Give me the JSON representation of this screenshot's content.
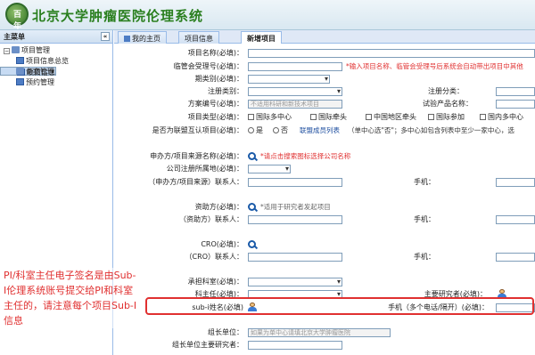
{
  "app": {
    "logo_mark": "百年",
    "title": "北京大学肿瘤医院伦理系统"
  },
  "sidebar": {
    "header": "主菜单",
    "collapse": "«",
    "root": "项目管理",
    "items": [
      {
        "label": "项目信息总览"
      },
      {
        "label": "项目信息"
      },
      {
        "label": "备案管理"
      },
      {
        "label": "预约管理"
      }
    ]
  },
  "tabs": [
    {
      "label": "我的主页"
    },
    {
      "label": "项目信息"
    },
    {
      "label": "新增项目"
    }
  ],
  "form": {
    "project_name": "项目名称(必填)：",
    "committee_no": "临管会受理号(必填)：",
    "committee_hint": "*输入项目名称、临管会受理号后系统会自动带出项目中其他",
    "phase": "期类别(必填)：",
    "reg_type": "注册类别：",
    "reg_class": "注册分类：",
    "protocol_no": "方案编号(必填)：",
    "protocol_placeholder": "不适用科研和新技术项目",
    "product_name": "试验产品名称：",
    "project_type": "项目类型(必填)：",
    "type_options": [
      "国际多中心",
      "国际牵头",
      "中国地区牵头",
      "国际参加",
      "国内多中心"
    ],
    "joint_review": "是否为联盟互认项目(必填)：",
    "yes": "是",
    "no": "否",
    "alliance_link": "联盟成员列表",
    "alliance_note": "（单中心选\"否\"；多中心如包含列表中至少一家中心，选",
    "applicant": "申办方/项目来源名称(必填)：",
    "applicant_hint": "*请点击搜索图标选择公司名称",
    "company_country": "公司注册所属地(必填)：",
    "applicant_contact": "（申办方/项目来源）联系人：",
    "phone1": "手机：",
    "sponsor": "资助方(必填)：",
    "sponsor_hint": "*适用于研究者发起项目",
    "sponsor_contact": "（资助方）联系人：",
    "phone2": "手机：",
    "cro": "CRO(必填)：",
    "cro_contact": "（CRO）联系人：",
    "phone3": "手机：",
    "undertake_dept": "承担科室(必填)：",
    "dept_head": "科主任(必填)：",
    "main_researcher": "主要研究者(必填)：",
    "sub_i_name": "sub-i姓名(必填)",
    "sub_i_phone": "手机（多个电话/隔开）(必填)：",
    "leader_unit": "组长单位：",
    "leader_placeholder": "如果为单中心请填北京大学肿瘤医院",
    "leader_researcher": "组长单位主要研究者："
  },
  "annotation": "PI/科室主任电子签名是由Sub-I伦理系统账号提交给PI和科室主任的，请注意每个项目Sub-I信息",
  "colors": {
    "brand_green": "#2a7f1f",
    "annotation_red": "#e03030",
    "link_blue": "#2050a0"
  }
}
